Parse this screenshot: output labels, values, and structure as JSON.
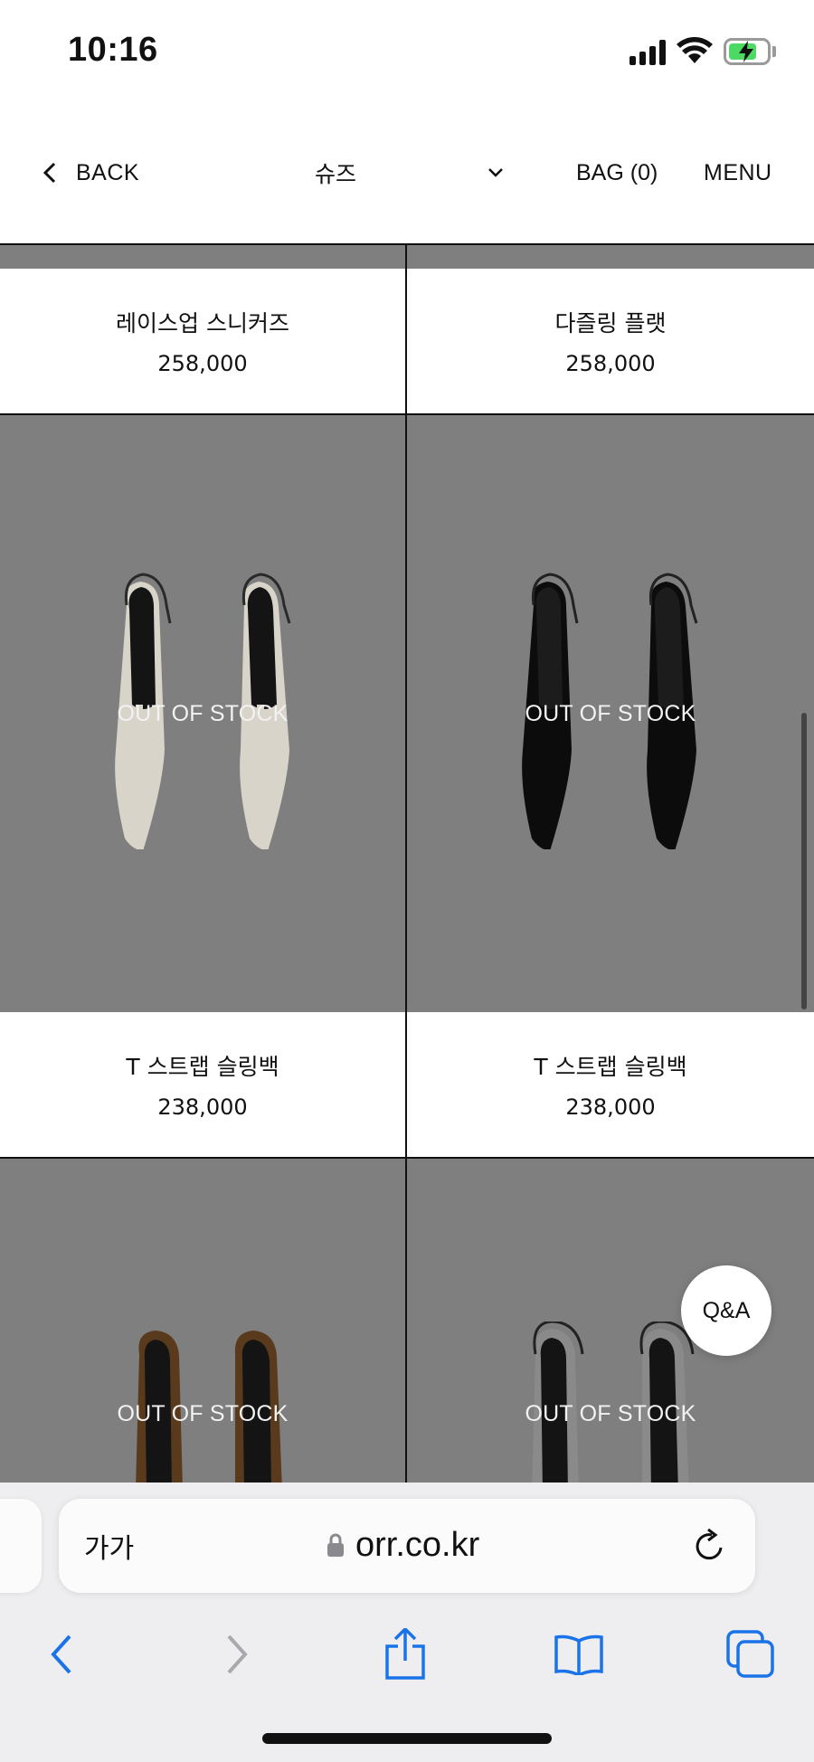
{
  "status_bar": {
    "time": "10:16"
  },
  "header": {
    "back_label": "BACK",
    "category": "슈즈",
    "bag_label": "BAG (0)",
    "menu_label": "MENU"
  },
  "products": [
    {
      "name": "레이스업 스니커즈",
      "price": "258,000"
    },
    {
      "name": "다즐링 플랫",
      "price": "258,000"
    },
    {
      "name": "T 스트랩 슬링백",
      "price": "238,000",
      "status": "OUT OF STOCK",
      "color": "#d8d4ca"
    },
    {
      "name": "T 스트랩 슬링백",
      "price": "238,000",
      "status": "OUT OF STOCK",
      "color": "#0c0c0c"
    },
    {
      "status": "OUT OF STOCK",
      "color": "#5a3a1c"
    },
    {
      "status": "OUT OF STOCK",
      "color": "#8a8a8a"
    }
  ],
  "qa_button": "Q&A",
  "browser": {
    "text_size_button": "가가",
    "url": "orr.co.kr"
  }
}
